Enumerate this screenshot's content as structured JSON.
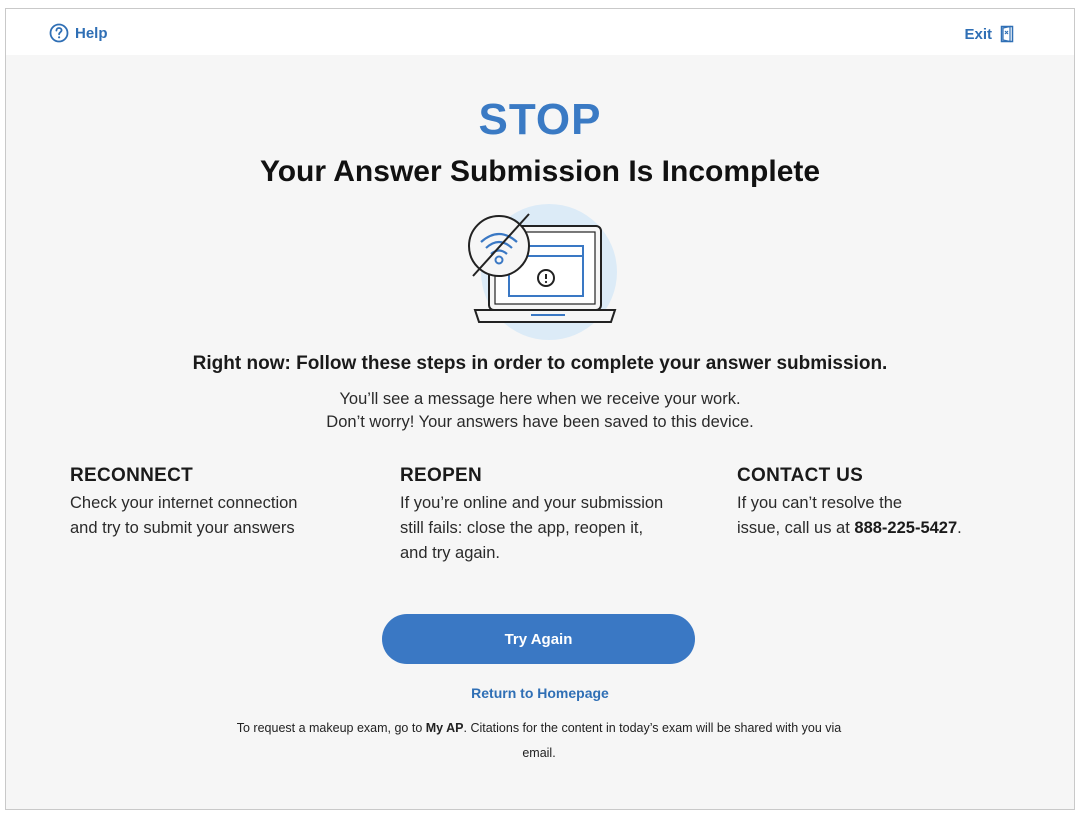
{
  "header": {
    "help_label": "Help",
    "exit_label": "Exit"
  },
  "main": {
    "stop": "STOP",
    "heading": "Your Answer Submission Is Incomplete",
    "steps_title": "Right now: Follow these steps in order to complete your answer submission.",
    "info_line1": "You’ll see a message here when we receive your work.",
    "info_line2": "Don’t worry! Your answers have been saved to this device."
  },
  "steps": [
    {
      "title": "RECONNECT",
      "line1": "Check your internet connection",
      "line2": "and try to submit your answers"
    },
    {
      "title": "REOPEN",
      "line1": "If you’re online and your submission",
      "line2": "still fails: close the app, reopen it,",
      "line3": "and try again."
    },
    {
      "title": "CONTACT US",
      "line1": "If you can’t resolve the",
      "line2_pre": "issue, call us at ",
      "phone": "888-225-5427",
      "line2_post": "."
    }
  ],
  "actions": {
    "try_again": "Try Again",
    "return_home": "Return to Homepage"
  },
  "footer": {
    "pre": "To request a makeup exam, go to ",
    "link": "My AP",
    "post": ". Citations for the content in today’s exam will be shared with you via",
    "line2": "email."
  },
  "colors": {
    "accent": "#3a78c4",
    "link": "#2f6fb5",
    "background": "#f6f6f6"
  },
  "icons": {
    "help": "question-circle-icon",
    "exit": "exit-door-icon",
    "illustration": "no-wifi-laptop-icon"
  }
}
